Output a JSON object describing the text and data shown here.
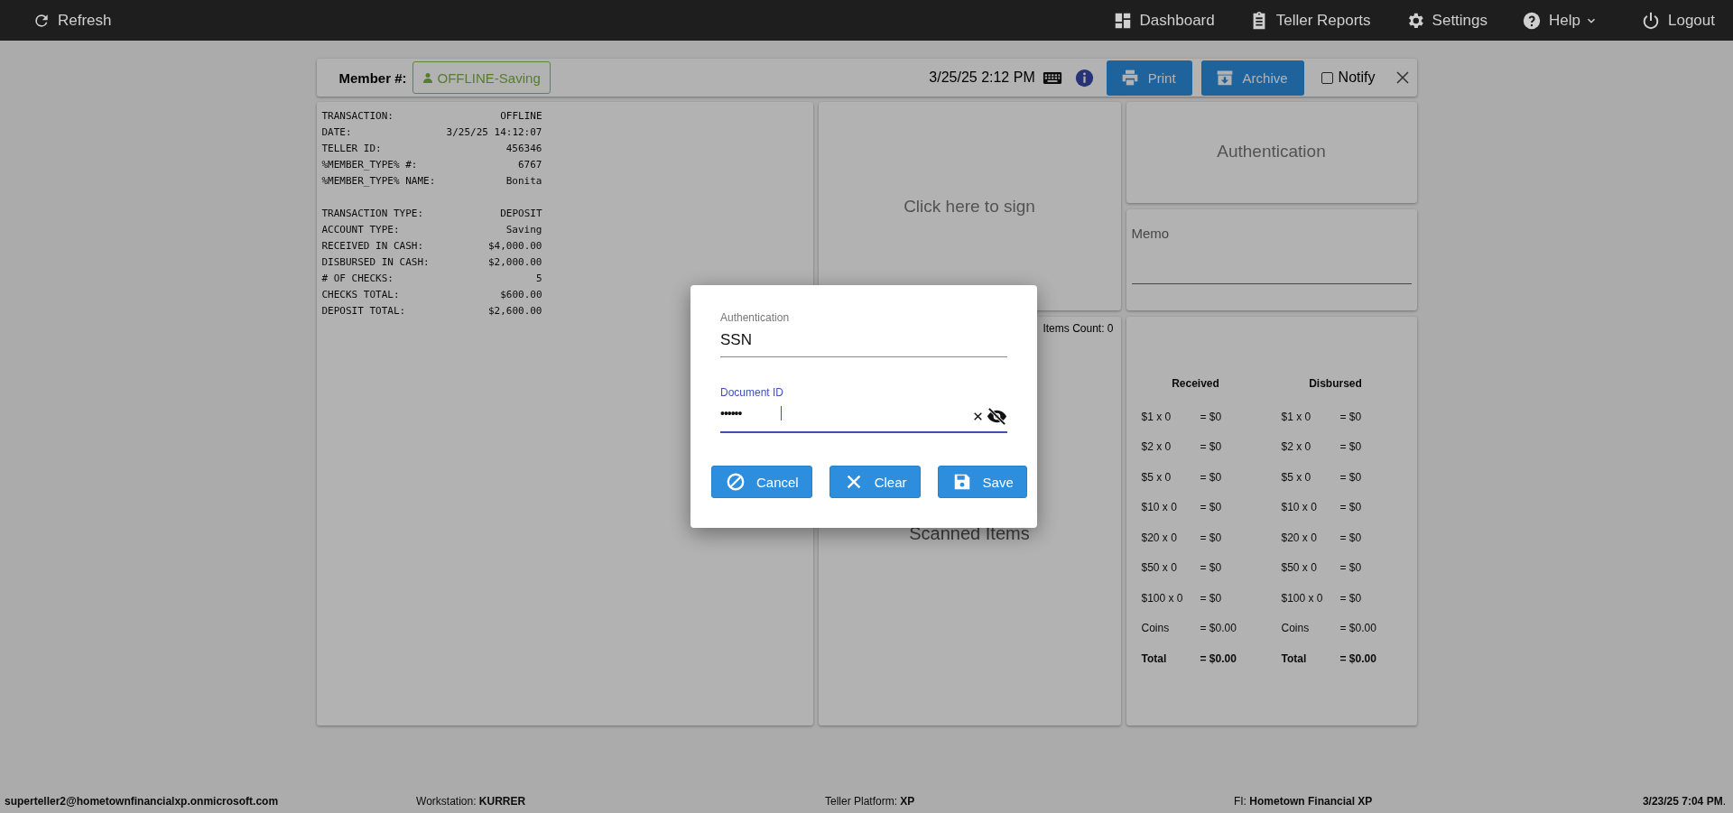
{
  "top_bar": {
    "refresh": {
      "label": "Refresh"
    },
    "items": [
      {
        "label": "Dashboard",
        "dropdown": false
      },
      {
        "label": "Teller Reports",
        "dropdown": false
      },
      {
        "label": "Settings",
        "dropdown": false
      },
      {
        "label": "Help",
        "dropdown": true
      },
      {
        "label": "Logout",
        "dropdown": false
      }
    ]
  },
  "header": {
    "member_label": "Member #:",
    "member_button": "OFFLINE-Saving",
    "datetime": "3/25/25 2:12 PM",
    "buttons": [
      "Print",
      "Archive"
    ],
    "notify": {
      "label": "Notify",
      "checked": false
    }
  },
  "receipt": {
    "sections": [
      [
        {
          "label": "TRANSACTION:",
          "value": "OFFLINE"
        },
        {
          "label": "DATE:",
          "value": "3/25/25 14:12:07"
        },
        {
          "label": "TELLER ID:",
          "value": "456346"
        },
        {
          "label": "%MEMBER_TYPE% #:",
          "value": "6767"
        },
        {
          "label": "%MEMBER_TYPE% NAME:",
          "value": "Bonita"
        }
      ],
      [
        {
          "label": "TRANSACTION TYPE:",
          "value": "DEPOSIT"
        },
        {
          "label": "ACCOUNT TYPE:",
          "value": "Saving"
        },
        {
          "label": "RECEIVED IN CASH:",
          "value": "$4,000.00"
        },
        {
          "label": "DISBURSED IN CASH:",
          "value": "$2,000.00"
        },
        {
          "label": "# OF CHECKS:",
          "value": "5"
        },
        {
          "label": "CHECKS TOTAL:",
          "value": "$600.00"
        },
        {
          "label": "DEPOSIT TOTAL:",
          "value": "$2,600.00"
        }
      ]
    ]
  },
  "signature": {
    "prompt": "Click here to sign"
  },
  "scanned": {
    "count": "Items Count: 0",
    "title": "Scanned Items"
  },
  "authentication_card": {
    "title": "Authentication"
  },
  "memo": {
    "label": "Memo"
  },
  "cash": {
    "columns": [
      {
        "heading": "Received",
        "rows": [
          {
            "kind": "line",
            "denomination": "$1 x 0",
            "amount": "= $0"
          },
          {
            "kind": "line",
            "denomination": "$2 x 0",
            "amount": "= $0"
          },
          {
            "kind": "line",
            "denomination": "$5 x 0",
            "amount": "= $0"
          },
          {
            "kind": "line",
            "denomination": "$10 x 0",
            "amount": "= $0"
          },
          {
            "kind": "line",
            "denomination": "$20 x 0",
            "amount": "= $0"
          },
          {
            "kind": "line",
            "denomination": "$50 x 0",
            "amount": "= $0"
          },
          {
            "kind": "line",
            "denomination": "$100 x 0",
            "amount": "= $0"
          },
          {
            "kind": "line",
            "denomination": "Coins",
            "amount": "= $0.00"
          },
          {
            "kind": "total",
            "denomination": "Total",
            "amount": "= $0.00"
          }
        ]
      },
      {
        "heading": "Disbursed",
        "rows": [
          {
            "kind": "line",
            "denomination": "$1 x 0",
            "amount": "= $0"
          },
          {
            "kind": "line",
            "denomination": "$2 x 0",
            "amount": "= $0"
          },
          {
            "kind": "line",
            "denomination": "$5 x 0",
            "amount": "= $0"
          },
          {
            "kind": "line",
            "denomination": "$10 x 0",
            "amount": "= $0"
          },
          {
            "kind": "line",
            "denomination": "$20 x 0",
            "amount": "= $0"
          },
          {
            "kind": "line",
            "denomination": "$50 x 0",
            "amount": "= $0"
          },
          {
            "kind": "line",
            "denomination": "$100 x 0",
            "amount": "= $0"
          },
          {
            "kind": "line",
            "denomination": "Coins",
            "amount": "= $0.00"
          },
          {
            "kind": "total",
            "denomination": "Total",
            "amount": "= $0.00"
          }
        ]
      }
    ]
  },
  "status_bar": {
    "user": "superteller2@hometownfinancialxp.onmicrosoft.com",
    "items": [
      "Workstation: **KURRER**",
      "Teller Platform: **XP**",
      "FI: **Hometown Financial XP**"
    ],
    "datetime": "**3/23/25 7:04 PM**."
  },
  "dialog": {
    "fields": [
      {
        "kind": "select",
        "label": "Authentication",
        "value": "SSN",
        "focused": false
      },
      {
        "kind": "password",
        "label": "Document ID",
        "value": "••••••",
        "focused": true
      }
    ],
    "buttons": [
      "Cancel",
      "Clear",
      "Save"
    ]
  }
}
